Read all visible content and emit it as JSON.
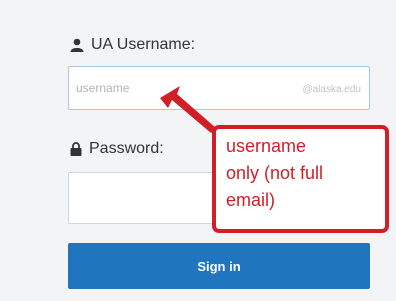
{
  "login": {
    "username_label": "UA Username:",
    "username_placeholder": "username",
    "username_suffix": "@alaska.edu",
    "password_label": "Password:",
    "signin_label": "Sign in"
  },
  "annotation": {
    "lines": [
      "username",
      "only (not full",
      "email)"
    ],
    "color": "#d01f26"
  },
  "icons": {
    "username": "user-icon",
    "password": "lock-icon"
  },
  "colors": {
    "button": "#1f76bf",
    "input_border_focus": "#a9c9e6"
  }
}
